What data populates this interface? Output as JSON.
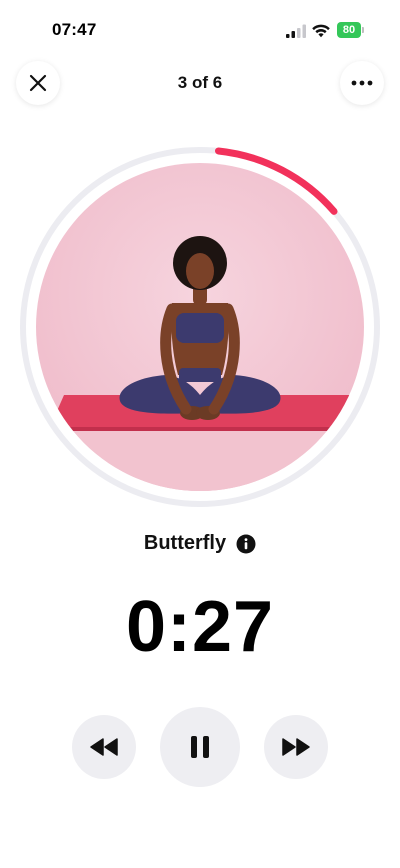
{
  "status_bar": {
    "time": "07:47",
    "battery_level": "80",
    "battery_color": "#34c759"
  },
  "header": {
    "progress_label": "3 of 6",
    "close_icon": "close-icon",
    "more_icon": "ellipsis-icon"
  },
  "exercise": {
    "name": "Butterfly",
    "timer": "0:27",
    "progress_fraction": 0.12,
    "ring_track_color": "#ececf1",
    "ring_progress_color": "#f2315b"
  },
  "controls": {
    "rewind_icon": "rewind-icon",
    "pause_icon": "pause-icon",
    "forward_icon": "fast-forward-icon"
  }
}
